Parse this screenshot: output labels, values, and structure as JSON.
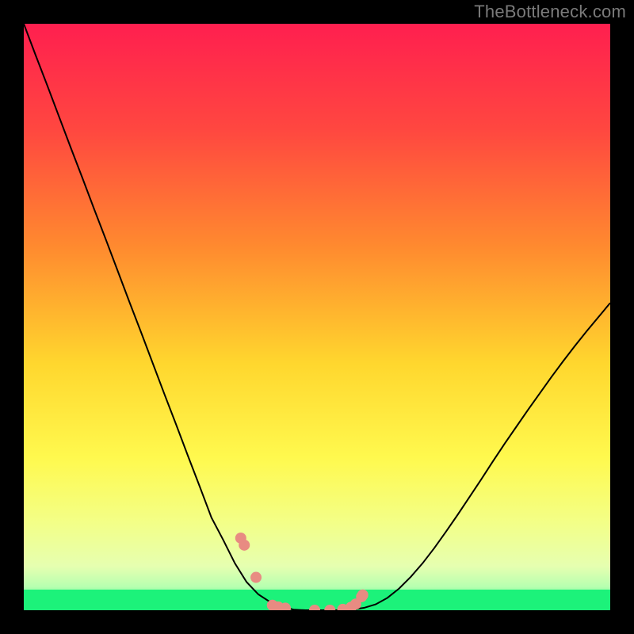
{
  "watermark": "TheBottleneck.com",
  "chart_data": {
    "type": "line",
    "title": "",
    "xlabel": "",
    "ylabel": "",
    "xlim": [
      0,
      100
    ],
    "ylim": [
      0,
      100
    ],
    "grid": false,
    "legend": "none",
    "background_gradient": {
      "top": "#ff1f4f",
      "mid_upper": "#ff7d2e",
      "mid": "#ffe62d",
      "mid_lower": "#f8ff7f",
      "band": "#d8ffb0",
      "bottom": "#1cf27a"
    },
    "series": [
      {
        "name": "curve",
        "color": "#000000",
        "stroke_width": 2,
        "x": [
          0,
          2,
          4,
          6,
          8,
          10,
          12,
          14,
          16,
          18,
          20,
          22,
          24,
          26,
          28,
          30,
          32,
          34,
          36,
          38,
          40,
          42,
          44,
          46,
          48,
          50,
          52,
          54,
          56,
          58,
          60,
          62,
          64,
          66,
          68,
          70,
          72,
          74,
          76,
          78,
          80,
          82,
          84,
          86,
          88,
          90,
          92,
          94,
          96,
          98,
          100
        ],
        "y": [
          100,
          94.7,
          89.5,
          84.2,
          78.9,
          73.7,
          68.4,
          63.2,
          57.9,
          52.6,
          47.4,
          42.1,
          36.8,
          31.6,
          26.3,
          21.1,
          15.8,
          12.0,
          8.0,
          4.8,
          2.7,
          1.4,
          0.6,
          0.1,
          0,
          0,
          0,
          0,
          0.1,
          0.4,
          1.0,
          2.1,
          3.7,
          5.7,
          8.0,
          10.6,
          13.4,
          16.3,
          19.3,
          22.3,
          25.4,
          28.4,
          31.3,
          34.2,
          37.0,
          39.8,
          42.5,
          45.1,
          47.6,
          50.0,
          52.4
        ]
      },
      {
        "name": "salmon-points",
        "color": "#e88b82",
        "marker": "circle",
        "radius": 7,
        "x": [
          37.0,
          37.6,
          39.6,
          42.4,
          43.4,
          44.6,
          49.6,
          52.2,
          54.4,
          55.8,
          56.6,
          57.6,
          57.8
        ],
        "y": [
          12.3,
          11.1,
          5.6,
          0.85,
          0.55,
          0.35,
          0.0,
          0.0,
          0.15,
          0.5,
          1.05,
          2.3,
          2.6
        ]
      }
    ],
    "accent_band": {
      "y": [
        0,
        4
      ],
      "color": "#1cf27a"
    }
  }
}
